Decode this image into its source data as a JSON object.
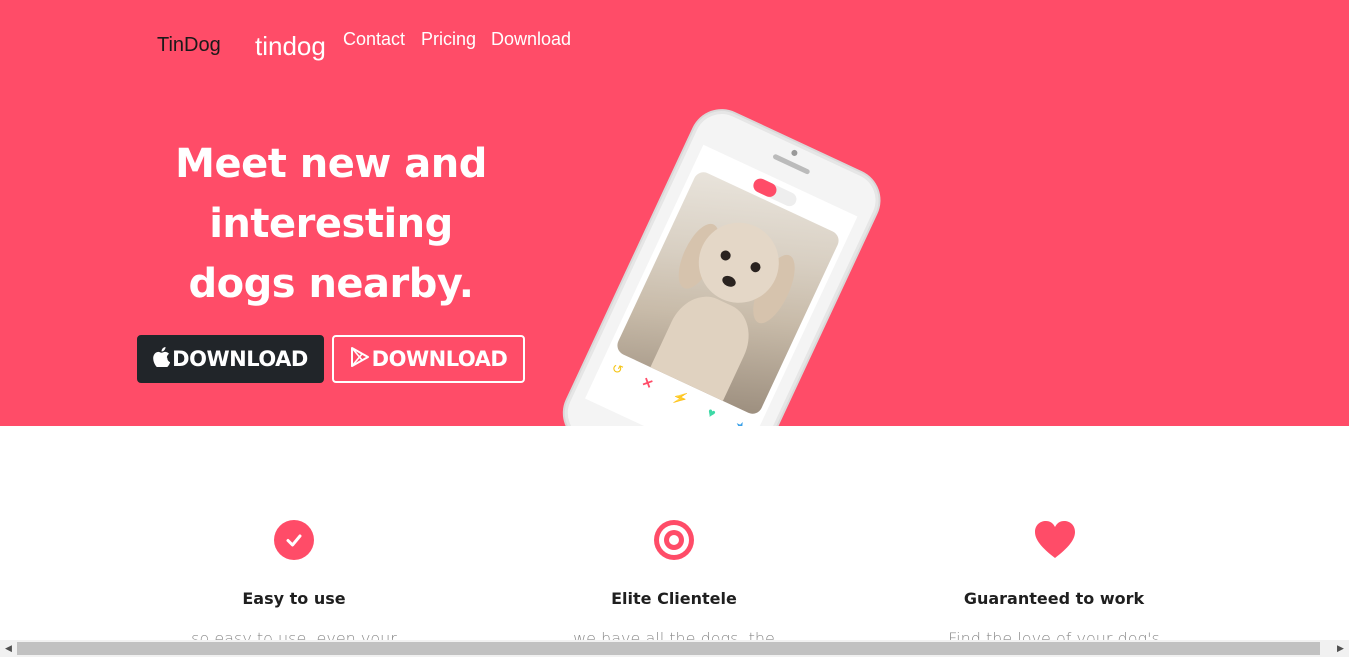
{
  "nav": {
    "brand_primary": "TinDog",
    "brand_secondary": "tindog",
    "links": [
      "Contact",
      "Pricing",
      "Download"
    ]
  },
  "hero": {
    "headline_line1": "Meet new and",
    "headline_line2": "interesting",
    "headline_line3": "dogs nearby.",
    "apple_button_label": "DOWNLOAD",
    "play_button_label": "DOWNLOAD",
    "apple_icon": "apple-icon",
    "play_icon": "play-store-icon"
  },
  "features": [
    {
      "icon": "check-circle-icon",
      "title": "Easy to use",
      "text": "so easy to use, even your"
    },
    {
      "icon": "bullseye-icon",
      "title": "Elite Clientele",
      "text": "we have all the dogs, the"
    },
    {
      "icon": "heart-icon",
      "title": "Guaranteed to work",
      "text": "Find the love of your dog's"
    }
  ],
  "colors": {
    "brand": "#ff4c68",
    "dark_button": "#212529",
    "text_dark": "#1f1f1f",
    "text_muted": "#8a8a8a"
  }
}
